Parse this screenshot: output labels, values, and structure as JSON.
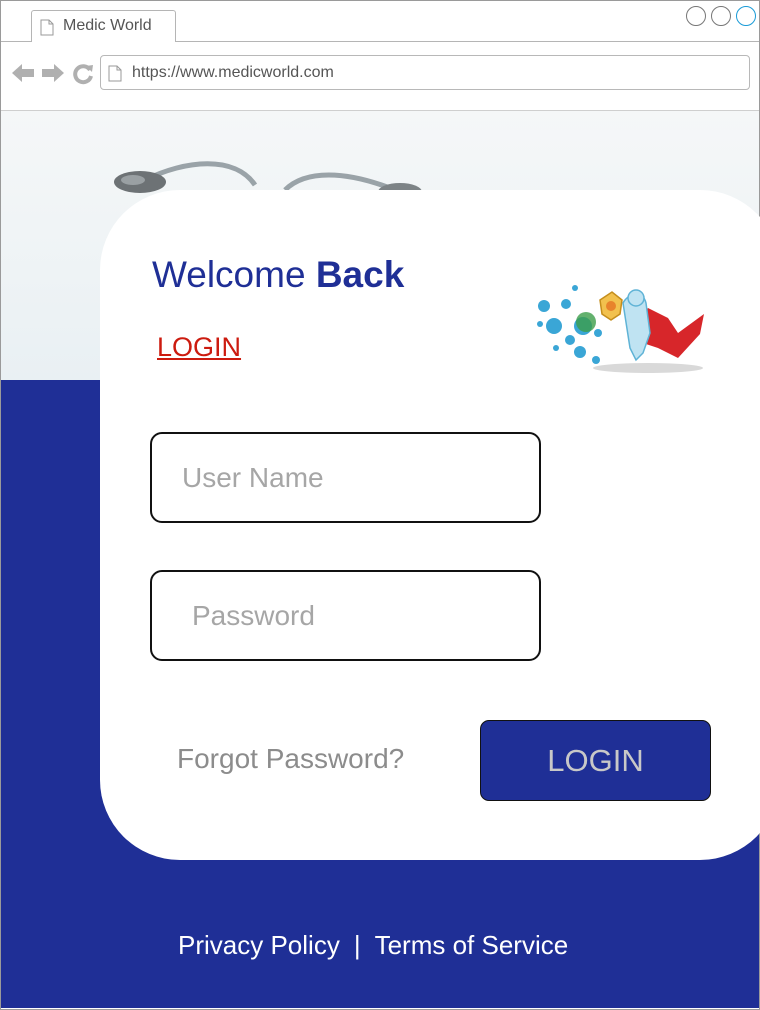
{
  "browser": {
    "tab_title": "Medic World",
    "url": "https://www.medicworld.com"
  },
  "icons": {
    "back": "arrow-left",
    "forward": "arrow-right",
    "reload": "refresh",
    "page": "document"
  },
  "login_card": {
    "welcome_prefix": "Welcome ",
    "welcome_bold": "Back",
    "login_link": "LOGIN",
    "username_placeholder": "User Name",
    "password_placeholder": "Password",
    "forgot_password": "Forgot Password?",
    "login_button": "LOGIN"
  },
  "footer": {
    "privacy": "Privacy Policy",
    "separator": "|",
    "terms": "Terms of Service"
  },
  "colors": {
    "brand_blue": "#1f2f96",
    "link_red": "#cc1b0f"
  }
}
